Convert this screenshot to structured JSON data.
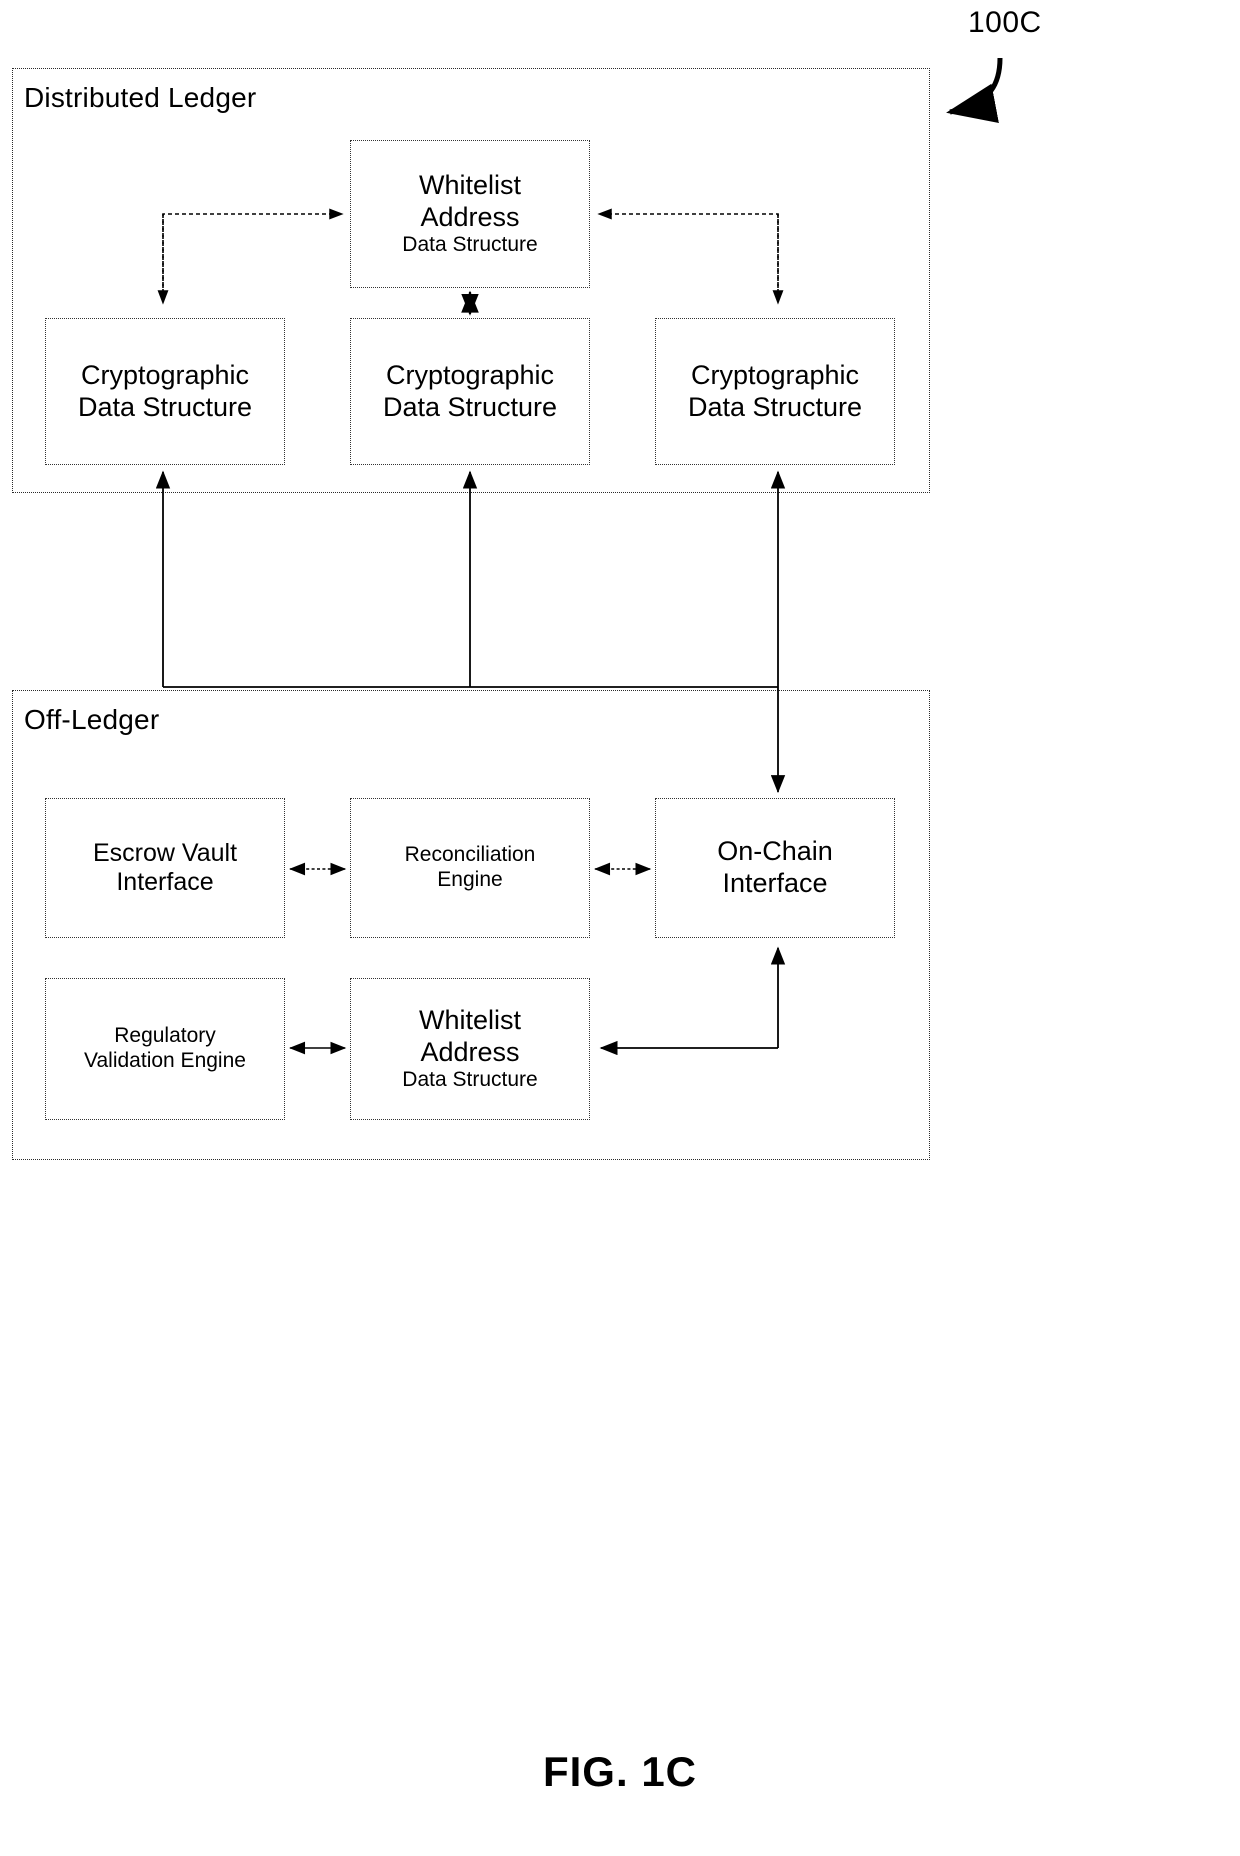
{
  "figure": {
    "reference_numeral": "100C",
    "caption": "FIG. 1C"
  },
  "containers": [
    {
      "id": "distributed-ledger",
      "title": "Distributed Ledger"
    },
    {
      "id": "off-ledger",
      "title": "Off-Ledger"
    }
  ],
  "distributed_ledger": {
    "title": "Distributed Ledger",
    "whitelist": {
      "line1": "Whitelist",
      "line2": "Address",
      "line3": "Data Structure"
    },
    "crypto_left": {
      "line1": "Cryptographic",
      "line2": "Data Structure"
    },
    "crypto_center": {
      "line1": "Cryptographic",
      "line2": "Data Structure"
    },
    "crypto_right": {
      "line1": "Cryptographic",
      "line2": "Data Structure"
    }
  },
  "off_ledger": {
    "title": "Off-Ledger",
    "escrow_vault": {
      "line1": "Escrow Vault",
      "line2": "Interface"
    },
    "reconciliation": {
      "line1": "Reconciliation",
      "line2": "Engine"
    },
    "on_chain": {
      "line1": "On-Chain",
      "line2": "Interface"
    },
    "regulatory": {
      "line1": "Regulatory",
      "line2": "Validation Engine"
    },
    "whitelist": {
      "line1": "Whitelist",
      "line2": "Address",
      "line3": "Data Structure"
    }
  },
  "colors": {
    "stroke": "#000000",
    "box_border": "#333333",
    "background": "#ffffff"
  },
  "connections": [
    {
      "from": "crypto-left",
      "to": "whitelist-ledger",
      "style": "dashed",
      "arrow": "both-ends-single"
    },
    {
      "from": "crypto-right",
      "to": "whitelist-ledger",
      "style": "dashed",
      "arrow": "both-ends-single"
    },
    {
      "from": "whitelist-ledger",
      "to": "crypto-center",
      "style": "solid",
      "arrow": "double"
    },
    {
      "from": "on-chain-interface",
      "to": "crypto-left",
      "style": "solid",
      "arrow": "single"
    },
    {
      "from": "on-chain-interface",
      "to": "crypto-center",
      "style": "solid",
      "arrow": "single"
    },
    {
      "from": "crypto-right",
      "to": "on-chain-interface",
      "style": "solid",
      "arrow": "double"
    },
    {
      "from": "escrow-vault-interface",
      "to": "reconciliation-engine",
      "style": "dashed",
      "arrow": "double"
    },
    {
      "from": "reconciliation-engine",
      "to": "on-chain-interface",
      "style": "dashed",
      "arrow": "double"
    },
    {
      "from": "regulatory-validation-engine",
      "to": "whitelist-offledger",
      "style": "solid",
      "arrow": "double"
    },
    {
      "from": "whitelist-offledger",
      "to": "on-chain-interface",
      "style": "solid",
      "arrow": "single"
    }
  ]
}
